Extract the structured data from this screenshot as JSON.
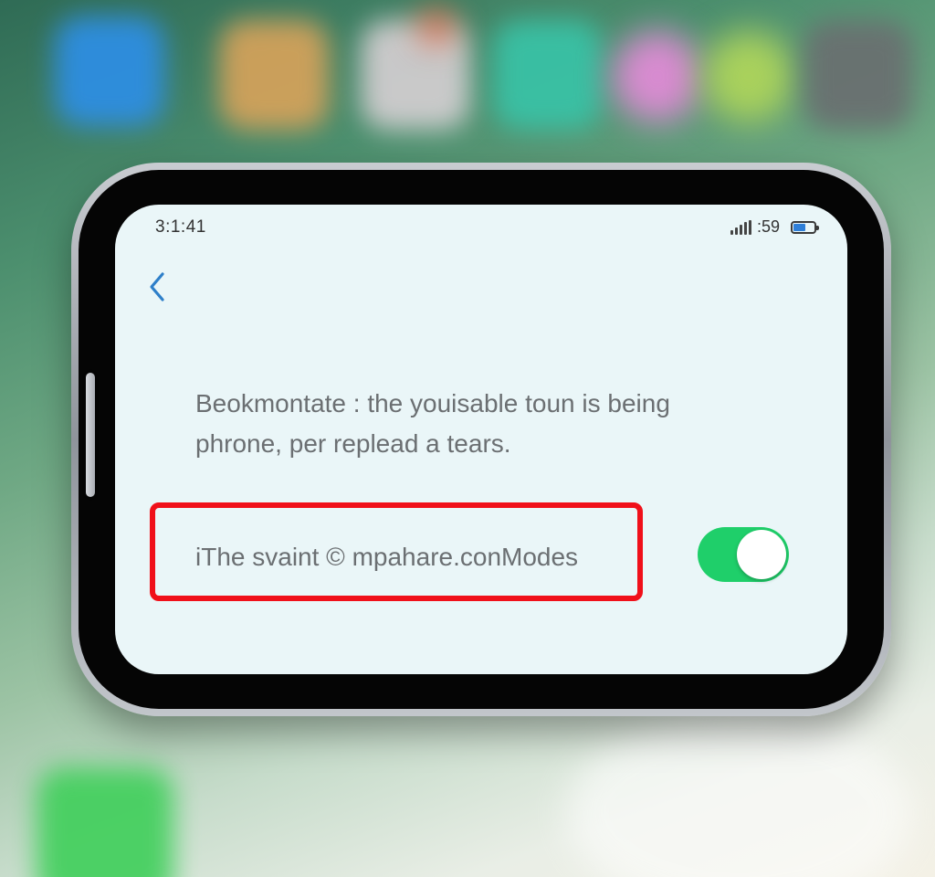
{
  "status_bar": {
    "time": "3:1:41",
    "signal_text": ":59",
    "battery_level": 0.6
  },
  "nav": {
    "back_icon": "chevron-left-icon"
  },
  "content": {
    "message_line1": "Beokmontate : the youisable toun is being",
    "message_line2": "phrone, per replead a tears."
  },
  "setting": {
    "label": "iThe svaint © mpahare.conModes",
    "toggle_on": true,
    "toggle_color": "#1fcf6a",
    "highlight_color": "#f0101a"
  }
}
